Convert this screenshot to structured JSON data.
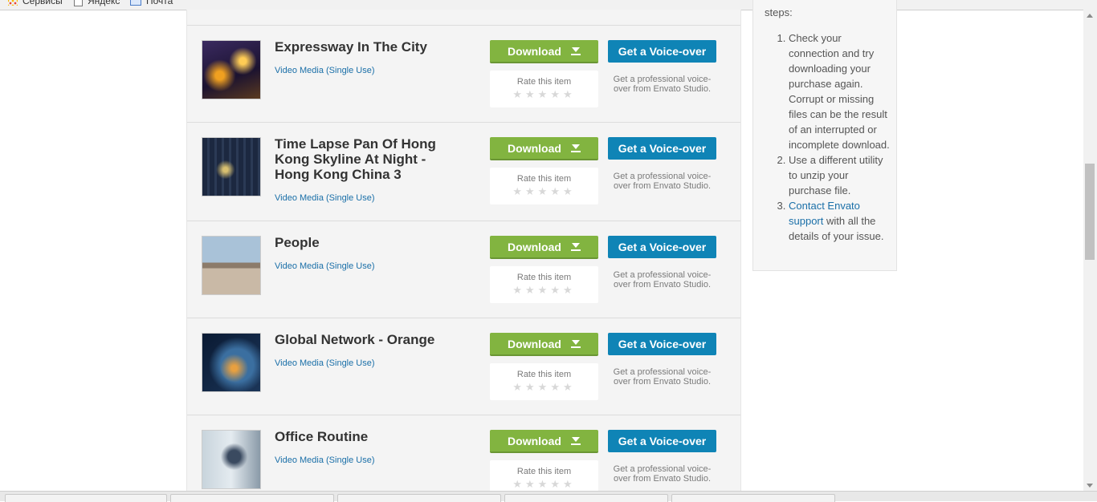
{
  "bookmarks": [
    {
      "label": "Сервисы",
      "icon": "apps-grid-icon"
    },
    {
      "label": "Яндекс",
      "icon": "page-icon"
    },
    {
      "label": "Почта",
      "icon": "mail-icon"
    }
  ],
  "items": [
    {
      "title": "Expressway In The City",
      "license": "Video Media (Single Use)",
      "download_label": "Download",
      "rate_label": "Rate this item",
      "stars": "★★★★★",
      "voiceover_label": "Get a Voice-over",
      "voiceover_text": "Get a professional voice-over from Envato Studio.",
      "thumb_colors": [
        "#1b1230",
        "#f0a020",
        "#3a2a60"
      ]
    },
    {
      "title": "Time Lapse Pan Of Hong Kong Skyline At Night - Hong Kong China 3",
      "license": "Video Media (Single Use)",
      "download_label": "Download",
      "rate_label": "Rate this item",
      "stars": "★★★★★",
      "voiceover_label": "Get a Voice-over",
      "voiceover_text": "Get a professional voice-over from Envato Studio.",
      "thumb_colors": [
        "#0d1628",
        "#d8c070",
        "#2b3a55"
      ]
    },
    {
      "title": "People",
      "license": "Video Media (Single Use)",
      "download_label": "Download",
      "rate_label": "Rate this item",
      "stars": "★★★★★",
      "voiceover_label": "Get a Voice-over",
      "voiceover_text": "Get a professional voice-over from Envato Studio.",
      "thumb_colors": [
        "#a9c2d8",
        "#8c7b6a",
        "#c9b9a6"
      ]
    },
    {
      "title": "Global Network - Orange",
      "license": "Video Media (Single Use)",
      "download_label": "Download",
      "rate_label": "Rate this item",
      "stars": "★★★★★",
      "voiceover_label": "Get a Voice-over",
      "voiceover_text": "Get a professional voice-over from Envato Studio.",
      "thumb_colors": [
        "#0a1a33",
        "#e8a040",
        "#3b6fa0"
      ]
    },
    {
      "title": "Office Routine",
      "license": "Video Media (Single Use)",
      "download_label": "Download",
      "rate_label": "Rate this item",
      "stars": "★★★★★",
      "voiceover_label": "Get a Voice-over",
      "voiceover_text": "Get a professional voice-over from Envato Studio.",
      "thumb_colors": [
        "#c8d4dc",
        "#3a4a60",
        "#8a9aa8"
      ]
    }
  ],
  "sidebar": {
    "steps_intro": "steps:",
    "steps": [
      {
        "text": "Check your connection and try downloading your purchase again. Corrupt or missing files can be the result of an interrupted or incomplete download."
      },
      {
        "text": "Use a different utility to unzip your purchase file."
      },
      {
        "link": "Contact Envato support",
        "text": " with all the details of your issue."
      }
    ]
  },
  "colors": {
    "download_green": "#82b440",
    "voiceover_blue": "#0f84b6",
    "link_blue": "#1a6fa8"
  }
}
